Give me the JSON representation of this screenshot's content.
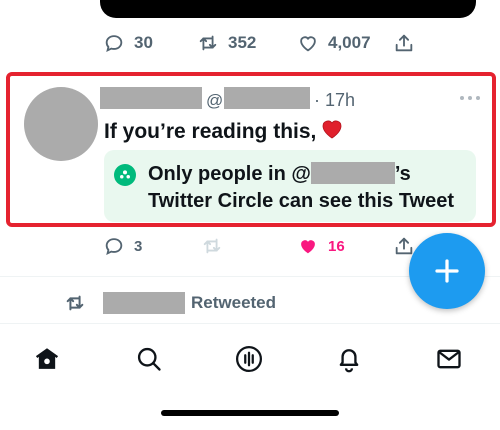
{
  "previous_tweet": {
    "reply_count": "30",
    "retweet_count": "352",
    "like_count": "4,007"
  },
  "tweet": {
    "handle_prefix": "@",
    "time": "· 17h",
    "text": "If you’re reading this,",
    "emoji_icon": "red-heart-emoji",
    "circle_notice_line1_prefix": "Only people in @",
    "circle_notice_line1_suffix": "’s",
    "circle_notice_line2": "Twitter Circle can see this Tweet",
    "reply_count": "3",
    "like_count": "16",
    "liked": true
  },
  "next_tweet": {
    "retweeted_label": "Retweeted"
  },
  "nav": {
    "items": [
      "home-icon",
      "search-icon",
      "spaces-icon",
      "notifications-icon",
      "messages-icon"
    ]
  },
  "colors": {
    "accent": "#1d9bf0",
    "like": "#f91880",
    "circle_green": "#00ba7c",
    "highlight_border": "#e5222f",
    "muted": "#536471"
  }
}
